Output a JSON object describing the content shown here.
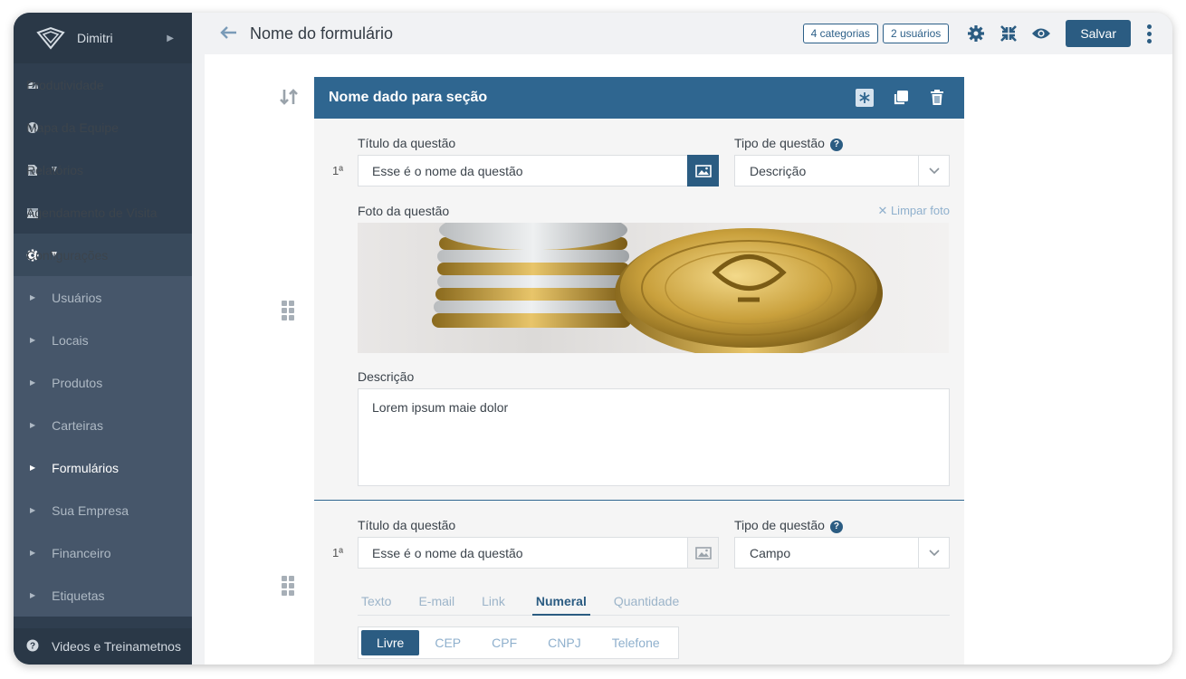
{
  "sidebar": {
    "user": "Dimitri",
    "items": [
      {
        "label": "Produtividade",
        "icon": "dashboard-icon"
      },
      {
        "label": "Mapa da Equipe",
        "icon": "globe-icon"
      },
      {
        "label": "Relatórios",
        "icon": "document-icon"
      },
      {
        "label": "Agendamento de Visita",
        "icon": "calendar-icon"
      },
      {
        "label": "Configurações",
        "icon": "gear-icon"
      }
    ],
    "subitems": [
      "Usuários",
      "Locais",
      "Produtos",
      "Carteiras",
      "Formulários",
      "Sua Empresa",
      "Financeiro",
      "Etiquetas"
    ],
    "bottom": "Videos e Treinametnos"
  },
  "topbar": {
    "title": "Nome do formulário",
    "categories": "4 categorias",
    "users": "2 usuários",
    "save": "Salvar"
  },
  "section": {
    "title": "Nome dado para seção"
  },
  "q1": {
    "title_label": "Título da questão",
    "type_label": "Tipo de questão",
    "number": "1ª",
    "title_value": "Esse é o nome da questão",
    "type_value": "Descrição",
    "photo_label": "Foto da questão",
    "clear_photo": "Limpar foto",
    "desc_label": "Descrição",
    "desc_value": "Lorem ipsum maie dolor"
  },
  "q2": {
    "title_label": "Título da questão",
    "type_label": "Tipo de questão",
    "number": "1ª",
    "title_value": "Esse é o nome da questão",
    "type_value": "Campo",
    "tabs": [
      "Texto",
      "E-mail",
      "Link",
      "Numeral",
      "Quantidade"
    ],
    "segments": [
      "Livre",
      "CEP",
      "CPF",
      "CNPJ",
      "Telefone"
    ]
  },
  "colors": {
    "sidebar": "#2f3e4f",
    "accent": "#2b5c82",
    "section_header": "#2f6690"
  }
}
